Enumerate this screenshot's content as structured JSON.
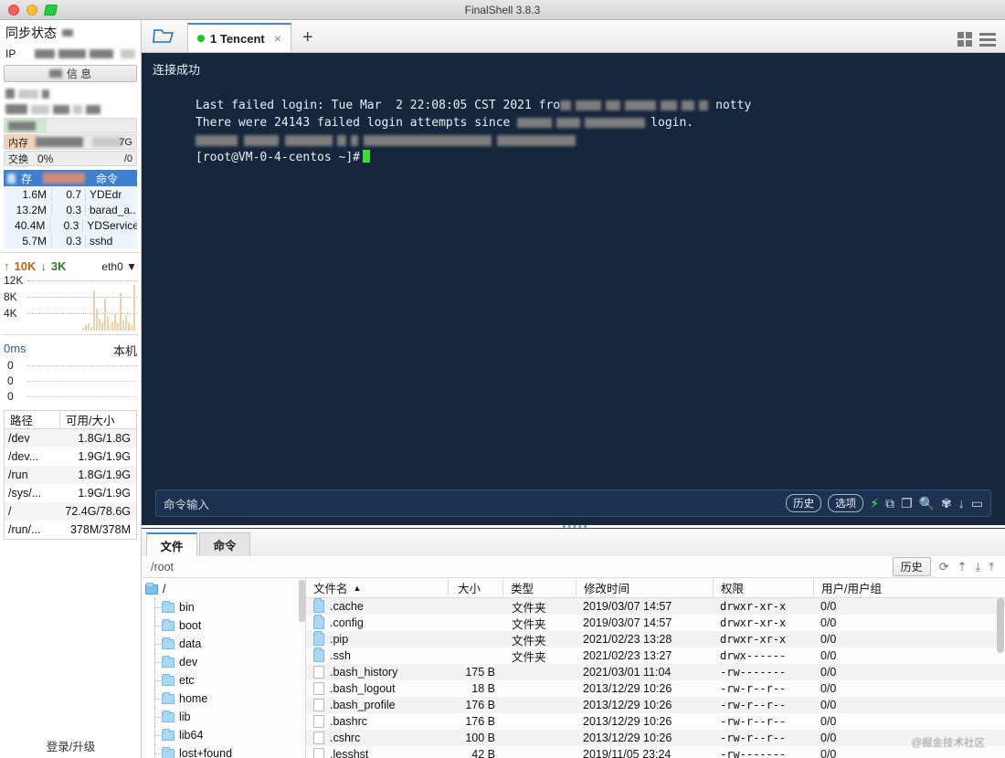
{
  "window": {
    "title": "FinalShell 3.8.3"
  },
  "sidebar": {
    "sync_status_label": "同步状态",
    "ip_label": "IP",
    "trust_chip_label": "信 息",
    "mem_label": "内存",
    "mem_value": "7G",
    "swap_label": "交换",
    "swap_percent": "0%",
    "swap_total": "/0",
    "process_header": {
      "col1": "内存",
      "col2": "CPU",
      "col3": "命令"
    },
    "processes": [
      {
        "mem": "1.6M",
        "cpu": "0.7",
        "cmd": "YDEdr"
      },
      {
        "mem": "13.2M",
        "cpu": "0.3",
        "cmd": "barad_a.."
      },
      {
        "mem": "40.4M",
        "cpu": "0.3",
        "cmd": "YDService"
      },
      {
        "mem": "5.7M",
        "cpu": "0.3",
        "cmd": "sshd"
      }
    ],
    "network": {
      "upload": "10K",
      "download": "3K",
      "interface": "eth0",
      "y_labels": [
        "12K",
        "8K",
        "4K"
      ],
      "bars": [
        5,
        8,
        12,
        6,
        72,
        38,
        20,
        14,
        58,
        22,
        10,
        16,
        30,
        12,
        70,
        18,
        26,
        12,
        8,
        84
      ]
    },
    "latency": {
      "value": "0ms",
      "host": "本机",
      "y_labels": [
        "0",
        "0",
        "0"
      ]
    },
    "disk": {
      "header": {
        "path": "路径",
        "usage": "可用/大小"
      },
      "rows": [
        {
          "path": "/dev",
          "usage": "1.8G/1.8G"
        },
        {
          "path": "/dev...",
          "usage": "1.9G/1.9G"
        },
        {
          "path": "/run",
          "usage": "1.8G/1.9G"
        },
        {
          "path": "/sys/...",
          "usage": "1.9G/1.9G"
        },
        {
          "path": "/",
          "usage": "72.4G/78.6G"
        },
        {
          "path": "/run/...",
          "usage": "378M/378M"
        }
      ]
    },
    "login_upgrade_label": "登录/升级"
  },
  "tabbar": {
    "folder_icon": "open-folder-icon",
    "tabs": [
      {
        "label": "1 Tencent",
        "close": "×",
        "status": "connected"
      }
    ],
    "new_tab": "+",
    "grid_icon": "grid-view-icon",
    "menu_icon": "hamburger-menu-icon"
  },
  "terminal": {
    "lines": [
      {
        "text": "连接成功",
        "redacted": false
      },
      {
        "text": "Last failed login: Tue Mar  2 22:08:05 CST 2021 fro",
        "redacted": true,
        "tail": "notty"
      },
      {
        "text": "There were 24143 failed login attempts since ",
        "redacted": true,
        "tail": "login."
      },
      {
        "text": "",
        "redacted": true,
        "tail": ""
      },
      {
        "text": "[root@VM-0-4-centos ~]# ",
        "redacted": false
      }
    ],
    "prompt": "[root@VM-0-4-centos ~]#",
    "cmdbar": {
      "placeholder": "命令输入",
      "history_label": "历史",
      "options_label": "选项",
      "icons": [
        "bolt-icon",
        "copy-icon",
        "paste-icon",
        "search-icon",
        "gear-icon",
        "download-icon",
        "window-icon"
      ]
    }
  },
  "bottom": {
    "tabs": [
      {
        "label": "文件",
        "active": true
      },
      {
        "label": "命令",
        "active": false
      }
    ],
    "path": "/root",
    "toolbar": {
      "history_label": "历史",
      "refresh_icon": "refresh-icon",
      "up-dir_icon": "parent-directory-icon",
      "download_icon": "download-icon",
      "upload_icon": "upload-icon"
    },
    "tree": {
      "root": "/",
      "nodes": [
        "bin",
        "boot",
        "data",
        "dev",
        "etc",
        "home",
        "lib",
        "lib64",
        "lost+found"
      ]
    },
    "columns": {
      "name": "文件名",
      "sort_indicator": "▲",
      "size": "大小",
      "type": "类型",
      "mtime": "修改时间",
      "perm": "权限",
      "owner": "用户/用户组"
    },
    "folder_type_label": "文件夹",
    "files": [
      {
        "name": ".cache",
        "icon": "folder",
        "size": "",
        "type": "文件夹",
        "mtime": "2019/03/07 14:57",
        "perm": "drwxr-xr-x",
        "owner": "0/0"
      },
      {
        "name": ".config",
        "icon": "folder",
        "size": "",
        "type": "文件夹",
        "mtime": "2019/03/07 14:57",
        "perm": "drwxr-xr-x",
        "owner": "0/0"
      },
      {
        "name": ".pip",
        "icon": "folder",
        "size": "",
        "type": "文件夹",
        "mtime": "2021/02/23 13:28",
        "perm": "drwxr-xr-x",
        "owner": "0/0"
      },
      {
        "name": ".ssh",
        "icon": "folder",
        "size": "",
        "type": "文件夹",
        "mtime": "2021/02/23 13:27",
        "perm": "drwx------",
        "owner": "0/0"
      },
      {
        "name": ".bash_history",
        "icon": "file",
        "size": "175 B",
        "type": "",
        "mtime": "2021/03/01 11:04",
        "perm": "-rw-------",
        "owner": "0/0"
      },
      {
        "name": ".bash_logout",
        "icon": "file",
        "size": "18 B",
        "type": "",
        "mtime": "2013/12/29 10:26",
        "perm": "-rw-r--r--",
        "owner": "0/0"
      },
      {
        "name": ".bash_profile",
        "icon": "file",
        "size": "176 B",
        "type": "",
        "mtime": "2013/12/29 10:26",
        "perm": "-rw-r--r--",
        "owner": "0/0"
      },
      {
        "name": ".bashrc",
        "icon": "file",
        "size": "176 B",
        "type": "",
        "mtime": "2013/12/29 10:26",
        "perm": "-rw-r--r--",
        "owner": "0/0"
      },
      {
        "name": ".cshrc",
        "icon": "file",
        "size": "100 B",
        "type": "",
        "mtime": "2013/12/29 10:26",
        "perm": "-rw-r--r--",
        "owner": "0/0"
      },
      {
        "name": ".lesshst",
        "icon": "file",
        "size": "42 B",
        "type": "",
        "mtime": "2019/11/05 23:24",
        "perm": "-rw-------",
        "owner": "0/0"
      }
    ],
    "watermark": "@掘金技术社区"
  },
  "colors": {
    "terminal_bg": "#16263c",
    "accent": "#3f8ae0",
    "tab_active_border": "#3f8ae0",
    "process_header_bg": "#3f7fd0",
    "status_green": "#21c421",
    "bolt_green": "#4ef04e"
  }
}
